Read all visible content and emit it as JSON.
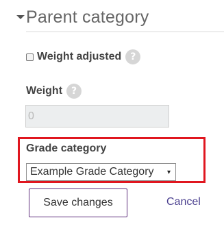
{
  "section": {
    "title": "Parent category",
    "collapse_icon": "triangle-down-icon"
  },
  "weight_adjusted": {
    "label": "Weight adjusted",
    "checked": false,
    "help_icon": "?"
  },
  "weight": {
    "label": "Weight",
    "help_icon": "?",
    "value": "0",
    "disabled": true
  },
  "grade_category": {
    "label": "Grade category",
    "selected": "Example Grade Category",
    "dropdown_icon": "▾",
    "highlight_color": "#e0161f"
  },
  "actions": {
    "save_label": "Save changes",
    "cancel_label": "Cancel"
  }
}
